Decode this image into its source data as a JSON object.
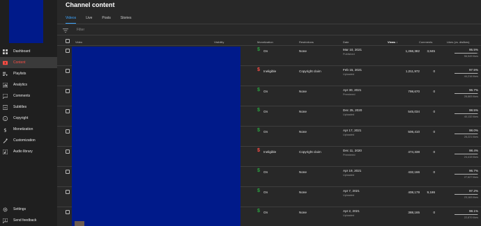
{
  "sidebar": {
    "items": [
      {
        "label": "Dashboard",
        "icon": "dashboard-icon"
      },
      {
        "label": "Content",
        "icon": "content-icon",
        "active": true
      },
      {
        "label": "Playlists",
        "icon": "playlists-icon"
      },
      {
        "label": "Analytics",
        "icon": "analytics-icon"
      },
      {
        "label": "Comments",
        "icon": "comments-icon"
      },
      {
        "label": "Subtitles",
        "icon": "subtitles-icon"
      },
      {
        "label": "Copyright",
        "icon": "copyright-icon"
      },
      {
        "label": "Monetization",
        "icon": "monetization-icon"
      },
      {
        "label": "Customization",
        "icon": "customization-icon"
      },
      {
        "label": "Audio library",
        "icon": "audio-library-icon"
      }
    ],
    "bottom": [
      {
        "label": "Settings",
        "icon": "gear-icon"
      },
      {
        "label": "Send feedback",
        "icon": "feedback-icon"
      }
    ]
  },
  "header": {
    "title": "Channel content",
    "tabs": [
      "Videos",
      "Live",
      "Posts",
      "Stories"
    ],
    "filter_placeholder": "Filter"
  },
  "table": {
    "columns": {
      "video": "Video",
      "visibility": "Visibility",
      "monetization": "Monetization",
      "restrictions": "Restrictions",
      "date": "Date",
      "views": "Views ↓",
      "comments": "Comments",
      "likes": "Likes (vs. dislikes)"
    },
    "rows": [
      {
        "mon_symbol": "$",
        "mon": "On",
        "mon_state": "on",
        "restrictions": "None",
        "date": "Mar 10, 2021",
        "date_status": "Published",
        "views": "1,266,382",
        "comments": "3,845",
        "likes_pct": "95.5%",
        "likes_count": "56,549 likes",
        "likes_ratio": 0.955
      },
      {
        "mon_symbol": "$",
        "mon": "Ineligible",
        "mon_state": "off",
        "restrictions": "Copyright claim",
        "date": "Feb 15, 2021",
        "date_status": "Uploaded",
        "views": "1,011,972",
        "comments": "0",
        "likes_pct": "97.5%",
        "likes_count": "44,216 likes",
        "likes_ratio": 0.975
      },
      {
        "mon_symbol": "$",
        "mon": "On",
        "mon_state": "on",
        "restrictions": "None",
        "date": "Apr 30, 2021",
        "date_status": "Premiered",
        "views": "798,670",
        "comments": "0",
        "likes_pct": "96.7%",
        "likes_count": "28,883 likes",
        "likes_ratio": 0.967
      },
      {
        "mon_symbol": "$",
        "mon": "On",
        "mon_state": "on",
        "restrictions": "None",
        "date": "Dec 25, 2020",
        "date_status": "Uploaded",
        "views": "545,034",
        "comments": "0",
        "likes_pct": "98.5%",
        "likes_count": "40,132 likes",
        "likes_ratio": 0.985
      },
      {
        "mon_symbol": "$",
        "mon": "On",
        "mon_state": "on",
        "restrictions": "None",
        "date": "Apr 17, 2021",
        "date_status": "Uploaded",
        "views": "506,410",
        "comments": "0",
        "likes_pct": "98.0%",
        "likes_count": "28,221 likes",
        "likes_ratio": 0.98
      },
      {
        "mon_symbol": "$",
        "mon": "Ineligible",
        "mon_state": "off",
        "restrictions": "Copyright claim",
        "date": "Dec 11, 2020",
        "date_status": "Premiered",
        "views": "474,338",
        "comments": "0",
        "likes_pct": "98.4%",
        "likes_count": "24,415 likes",
        "likes_ratio": 0.984
      },
      {
        "mon_symbol": "$",
        "mon": "On",
        "mon_state": "on",
        "restrictions": "None",
        "date": "Apr 19, 2021",
        "date_status": "Uploaded",
        "views": "432,166",
        "comments": "0",
        "likes_pct": "96.7%",
        "likes_count": "27,627 likes",
        "likes_ratio": 0.967
      },
      {
        "mon_symbol": "$",
        "mon": "On",
        "mon_state": "on",
        "restrictions": "None",
        "date": "Apr 7, 2021",
        "date_status": "Uploaded",
        "views": "408,179",
        "comments": "9,186",
        "likes_pct": "97.2%",
        "likes_count": "23,183 likes",
        "likes_ratio": 0.972
      },
      {
        "mon_symbol": "$",
        "mon": "On",
        "mon_state": "on",
        "restrictions": "None",
        "date": "Apr 2, 2021",
        "date_status": "Uploaded",
        "views": "388,165",
        "comments": "0",
        "likes_pct": "98.1%",
        "likes_count": "22,870 likes",
        "likes_ratio": 0.981
      }
    ]
  },
  "colors": {
    "accent": "#3ea6ff",
    "active_nav": "#ff4e45",
    "monetization_on": "#2ba640",
    "monetization_off": "#ff4e45",
    "redacted_block": "#001a8a"
  }
}
